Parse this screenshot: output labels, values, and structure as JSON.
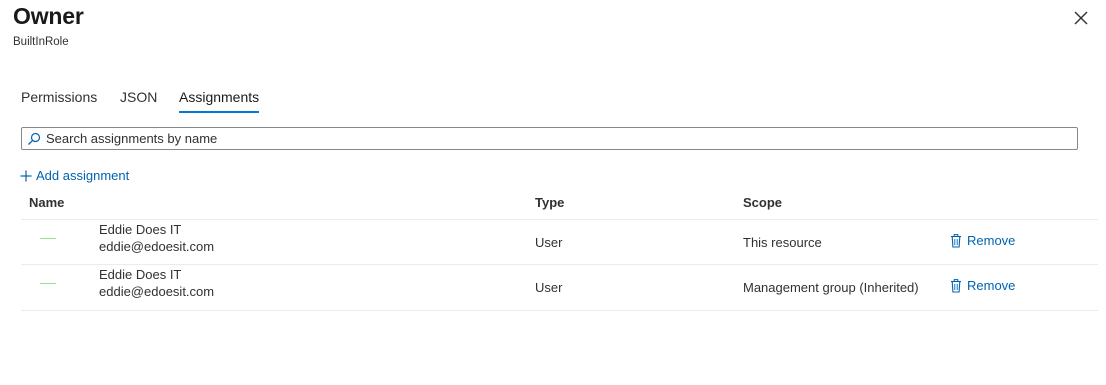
{
  "header": {
    "title": "Owner",
    "subtitle": "BuiltInRole",
    "close_icon": "close-icon"
  },
  "tabs": [
    {
      "label": "Permissions",
      "active": false
    },
    {
      "label": "JSON",
      "active": false
    },
    {
      "label": "Assignments",
      "active": true
    }
  ],
  "search": {
    "placeholder": "Search assignments by name",
    "value": "",
    "icon": "search-icon"
  },
  "toolbar": {
    "add_label": "Add assignment",
    "add_icon": "plus-icon"
  },
  "table": {
    "columns": [
      "Name",
      "Type",
      "Scope"
    ],
    "rows": [
      {
        "display_name": "Eddie Does IT",
        "email": "eddie@edoesit.com",
        "type": "User",
        "scope": "This resource",
        "action": "Remove"
      },
      {
        "display_name": "Eddie Does IT",
        "email": "eddie@edoesit.com",
        "type": "User",
        "scope": "Management group (Inherited)",
        "action": "Remove"
      }
    ]
  },
  "colors": {
    "accent": "#0078d4",
    "link": "#0063b1",
    "text": "#323130",
    "border": "#8a8886",
    "divider": "#edebe9"
  }
}
